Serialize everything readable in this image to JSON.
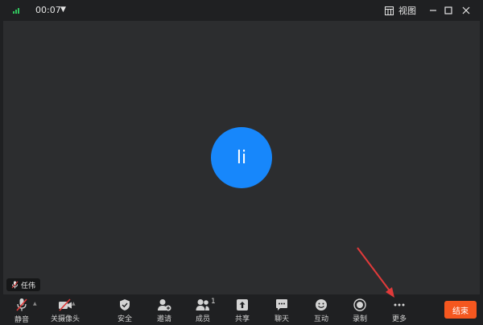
{
  "titlebar": {
    "timer": "00:07",
    "view_label": "视图"
  },
  "stage": {
    "avatar_initials": "li",
    "participant_name": "任伟"
  },
  "toolbar": {
    "items": [
      {
        "label": "静音"
      },
      {
        "label": "关摄像头"
      },
      {
        "label": "安全"
      },
      {
        "label": "邀请"
      },
      {
        "label": "成员",
        "count": "1"
      },
      {
        "label": "共享"
      },
      {
        "label": "聊天"
      },
      {
        "label": "互动"
      },
      {
        "label": "录制"
      },
      {
        "label": "更多"
      }
    ],
    "end_label": "结束"
  },
  "colors": {
    "accent": "#1787fb",
    "end_button": "#f5571f",
    "signal": "#31c45d",
    "annotation_arrow": "#e03a3a"
  }
}
